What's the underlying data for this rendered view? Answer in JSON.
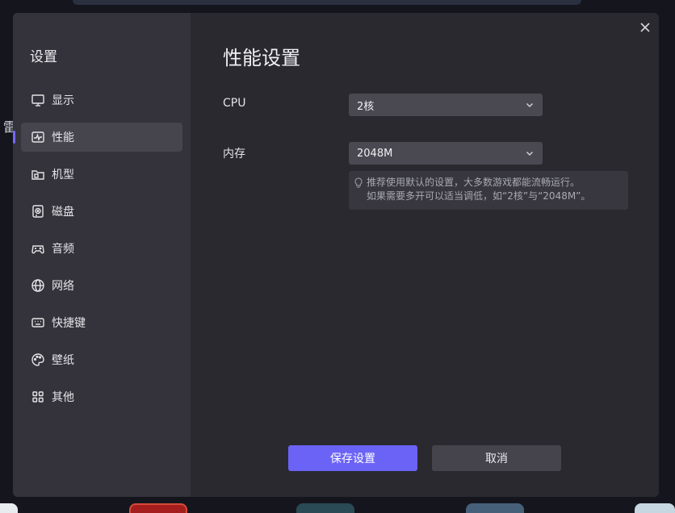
{
  "background": {
    "left_char": "雷"
  },
  "sidebar": {
    "title": "设置",
    "items": [
      {
        "label": "显示",
        "icon": "monitor-icon",
        "active": false
      },
      {
        "label": "性能",
        "icon": "performance-icon",
        "active": true
      },
      {
        "label": "机型",
        "icon": "device-icon",
        "active": false
      },
      {
        "label": "磁盘",
        "icon": "disk-icon",
        "active": false
      },
      {
        "label": "音频",
        "icon": "audio-icon",
        "active": false
      },
      {
        "label": "网络",
        "icon": "globe-icon",
        "active": false
      },
      {
        "label": "快捷键",
        "icon": "keyboard-icon",
        "active": false
      },
      {
        "label": "壁纸",
        "icon": "palette-icon",
        "active": false
      },
      {
        "label": "其他",
        "icon": "grid-icon",
        "active": false
      }
    ]
  },
  "main": {
    "title": "性能设置",
    "cpu": {
      "label": "CPU",
      "value": "2核"
    },
    "memory": {
      "label": "内存",
      "value": "2048M"
    },
    "hint": {
      "line1": "推荐使用默认的设置，大多数游戏都能流畅运行。",
      "line2": "如果需要多开可以适当调低，如“2核”与“2048M”。"
    },
    "save_label": "保存设置",
    "cancel_label": "取消"
  },
  "colors": {
    "accent": "#6b63f5",
    "sidebar_bg": "#34333b",
    "main_bg": "#2a2930"
  }
}
